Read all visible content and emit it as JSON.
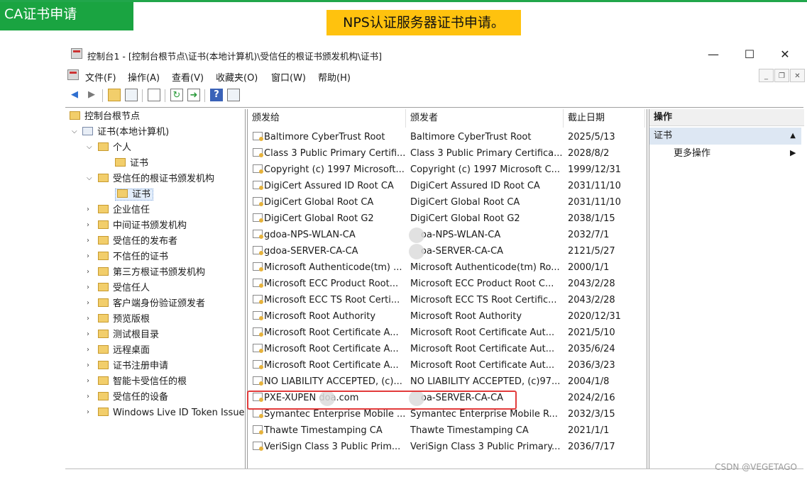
{
  "header": {
    "badge": "CA证书申请",
    "banner": "NPS认证服务器证书申请。"
  },
  "window": {
    "title": "控制台1 - [控制台根节点\\证书(本地计算机)\\受信任的根证书颁发机构\\证书]",
    "controls": {
      "minimize": "—",
      "maximize": "☐",
      "close": "✕"
    },
    "mdi_controls": {
      "minimize": "_",
      "restore": "❐",
      "close": "✕"
    }
  },
  "menu": [
    "文件(F)",
    "操作(A)",
    "查看(V)",
    "收藏夹(O)",
    "窗口(W)",
    "帮助(H)"
  ],
  "toolbar": {
    "back_icon": "back-arrow-icon",
    "forward_icon": "forward-arrow-icon"
  },
  "tree": {
    "root": "控制台根节点",
    "computer": "证书(本地计算机)",
    "personal": "个人",
    "personal_certs": "证书",
    "trusted_root": "受信任的根证书颁发机构",
    "trusted_root_certs": "证书",
    "others": [
      "企业信任",
      "中间证书颁发机构",
      "受信任的发布者",
      "不信任的证书",
      "第三方根证书颁发机构",
      "受信任人",
      "客户端身份验证颁发者",
      "预览版根",
      "测试根目录",
      "远程桌面",
      "证书注册申请",
      "智能卡受信任的根",
      "受信任的设备",
      "Windows Live ID Token Issuer"
    ]
  },
  "list": {
    "columns": [
      "颁发给",
      "颁发者",
      "截止日期"
    ],
    "rows": [
      [
        "Baltimore CyberTrust Root",
        "Baltimore CyberTrust Root",
        "2025/5/13"
      ],
      [
        "Class 3 Public Primary Certifi...",
        "Class 3 Public Primary Certifica...",
        "2028/8/2"
      ],
      [
        "Copyright (c) 1997 Microsoft...",
        "Copyright (c) 1997 Microsoft C...",
        "1999/12/31"
      ],
      [
        "DigiCert Assured ID Root CA",
        "DigiCert Assured ID Root CA",
        "2031/11/10"
      ],
      [
        "DigiCert Global Root CA",
        "DigiCert Global Root CA",
        "2031/11/10"
      ],
      [
        "DigiCert Global Root G2",
        "DigiCert Global Root G2",
        "2038/1/15"
      ],
      [
        "gdoa-NPS-WLAN-CA",
        "oa-NPS-WLAN-CA",
        "2032/7/1"
      ],
      [
        "gdoa-SERVER-CA-CA",
        "oa-SERVER-CA-CA",
        "2121/5/27"
      ],
      [
        "Microsoft Authenticode(tm) ...",
        "Microsoft Authenticode(tm) Ro...",
        "2000/1/1"
      ],
      [
        "Microsoft ECC Product Root...",
        "Microsoft ECC Product Root C...",
        "2043/2/28"
      ],
      [
        "Microsoft ECC TS Root Certi...",
        "Microsoft ECC TS Root Certific...",
        "2043/2/28"
      ],
      [
        "Microsoft Root Authority",
        "Microsoft Root Authority",
        "2020/12/31"
      ],
      [
        "Microsoft Root Certificate A...",
        "Microsoft Root Certificate Aut...",
        "2021/5/10"
      ],
      [
        "Microsoft Root Certificate A...",
        "Microsoft Root Certificate Aut...",
        "2035/6/24"
      ],
      [
        "Microsoft Root Certificate A...",
        "Microsoft Root Certificate Aut...",
        "2036/3/23"
      ],
      [
        "NO LIABILITY ACCEPTED, (c)...",
        "NO LIABILITY ACCEPTED, (c)97...",
        "2004/1/8"
      ],
      [
        "PXE-XUPEN    doa.com",
        "oa-SERVER-CA-CA",
        "2024/2/16"
      ],
      [
        "Symantec Enterprise Mobile ...",
        "Symantec Enterprise Mobile R...",
        "2032/3/15"
      ],
      [
        "Thawte Timestamping CA",
        "Thawte Timestamping CA",
        "2021/1/1"
      ],
      [
        "VeriSign Class 3 Public Prim...",
        "VeriSign Class 3 Public Primary...",
        "2036/7/17"
      ]
    ]
  },
  "actions": {
    "header": "操作",
    "section": "证书",
    "more": "更多操作"
  },
  "watermark": "CSDN @VEGETAGO"
}
